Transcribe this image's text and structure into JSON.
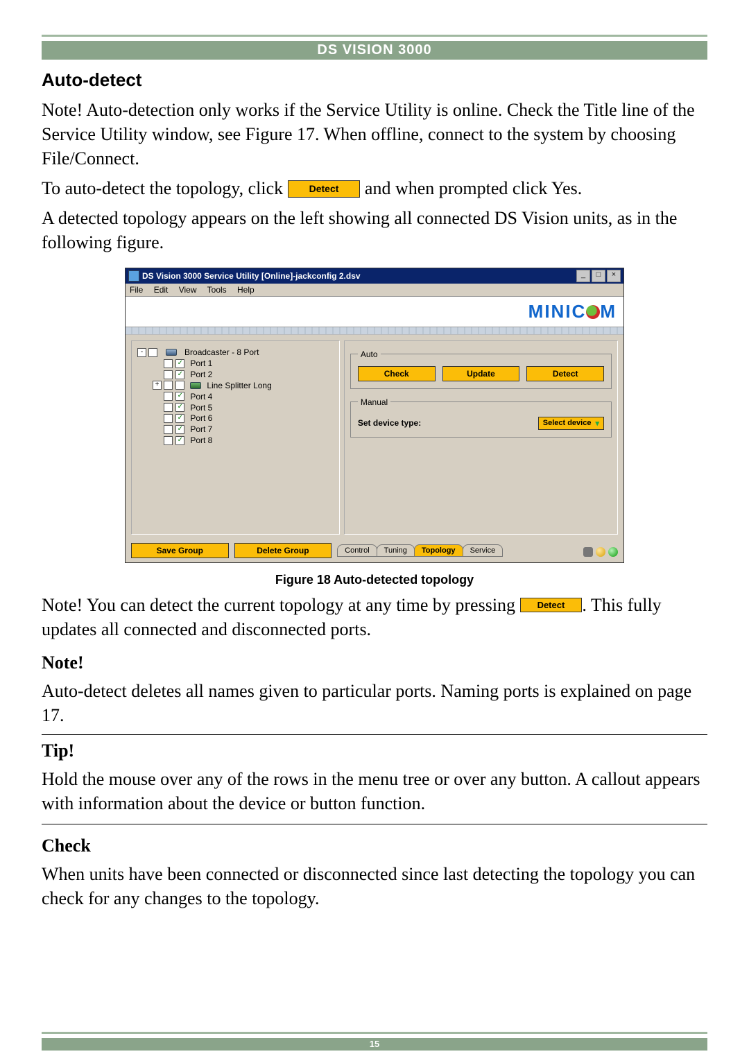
{
  "header": "DS VISION 3000",
  "section": {
    "auto_detect_title": "Auto-detect",
    "para1": "Note! Auto-detection only works if the Service Utility is online. Check the Title line of the Service Utility window, see Figure 17. When offline, connect to the system by choosing File/Connect.",
    "para2a": "To auto-detect the topology, click ",
    "para2b": " and when prompted click Yes.",
    "para3": "A detected topology appears on the left showing all connected DS Vision units, as in the following figure.",
    "para4a": "Note! You can detect the current topology at any time by pressing ",
    "para4b": ". This fully updates all connected and disconnected ports.",
    "note_title": "Note!",
    "para5": "Auto-detect deletes all names given to particular ports. Naming ports is explained on page 17.",
    "tip_title": "Tip!",
    "para6": "Hold the mouse over any of the rows in the menu tree or over any button. A callout appears with information about the device or button function.",
    "check_title": "Check",
    "para7": "When units have been connected or disconnected since last detecting the topology you can check for any changes to the topology."
  },
  "buttons": {
    "detect": "Detect"
  },
  "figure": {
    "caption": "Figure 18 Auto-detected topology"
  },
  "app": {
    "title": "DS Vision 3000 Service Utility [Online]-jackconfig 2.dsv",
    "menus": [
      "File",
      "Edit",
      "View",
      "Tools",
      "Help"
    ],
    "logo_text": "MINIC",
    "logo_text2": "M",
    "tree": {
      "root": "Broadcaster - 8 Port",
      "items": [
        {
          "checked": true,
          "label": "Port 1"
        },
        {
          "checked": true,
          "label": "Port 2"
        },
        {
          "checked": false,
          "label": "Line Splitter Long",
          "splitter": true
        },
        {
          "checked": true,
          "label": "Port 4"
        },
        {
          "checked": true,
          "label": "Port 5"
        },
        {
          "checked": true,
          "label": "Port 6"
        },
        {
          "checked": true,
          "label": "Port 7"
        },
        {
          "checked": true,
          "label": "Port 8"
        }
      ]
    },
    "auto_legend": "Auto",
    "auto_buttons": {
      "check": "Check",
      "update": "Update",
      "detect": "Detect"
    },
    "manual_legend": "Manual",
    "manual_label": "Set device type:",
    "manual_select": "Select device",
    "footer_left": {
      "save": "Save Group",
      "delete": "Delete Group"
    },
    "tabs": [
      "Control",
      "Tuning",
      "Topology",
      "Service"
    ],
    "active_tab": 2
  },
  "page_num": "15"
}
